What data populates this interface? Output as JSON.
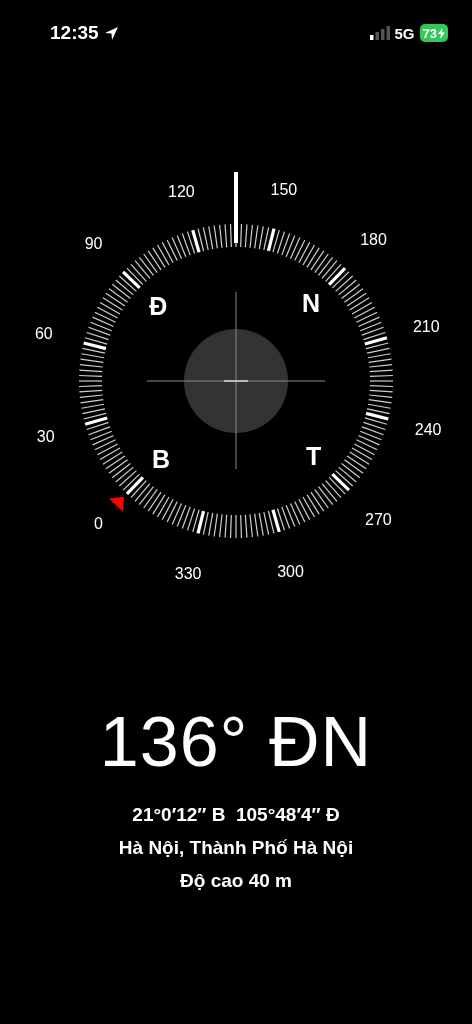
{
  "status_bar": {
    "time": "12:35",
    "network": "5G",
    "battery": "73"
  },
  "compass": {
    "degree_labels": [
      "0",
      "30",
      "60",
      "90",
      "120",
      "150",
      "180",
      "210",
      "240",
      "270",
      "300",
      "330"
    ],
    "cardinals": [
      {
        "kind": "east",
        "label": "Đ"
      },
      {
        "kind": "south",
        "label": "N"
      },
      {
        "kind": "north",
        "label": "B"
      },
      {
        "kind": "west",
        "label": "T"
      }
    ]
  },
  "heading": "136° ĐN",
  "coordinates": "21°0′12″ B  105°48′4″ Đ",
  "place": "Hà Nội, Thành Phố Hà Nội",
  "altitude": "Độ cao 40 m"
}
